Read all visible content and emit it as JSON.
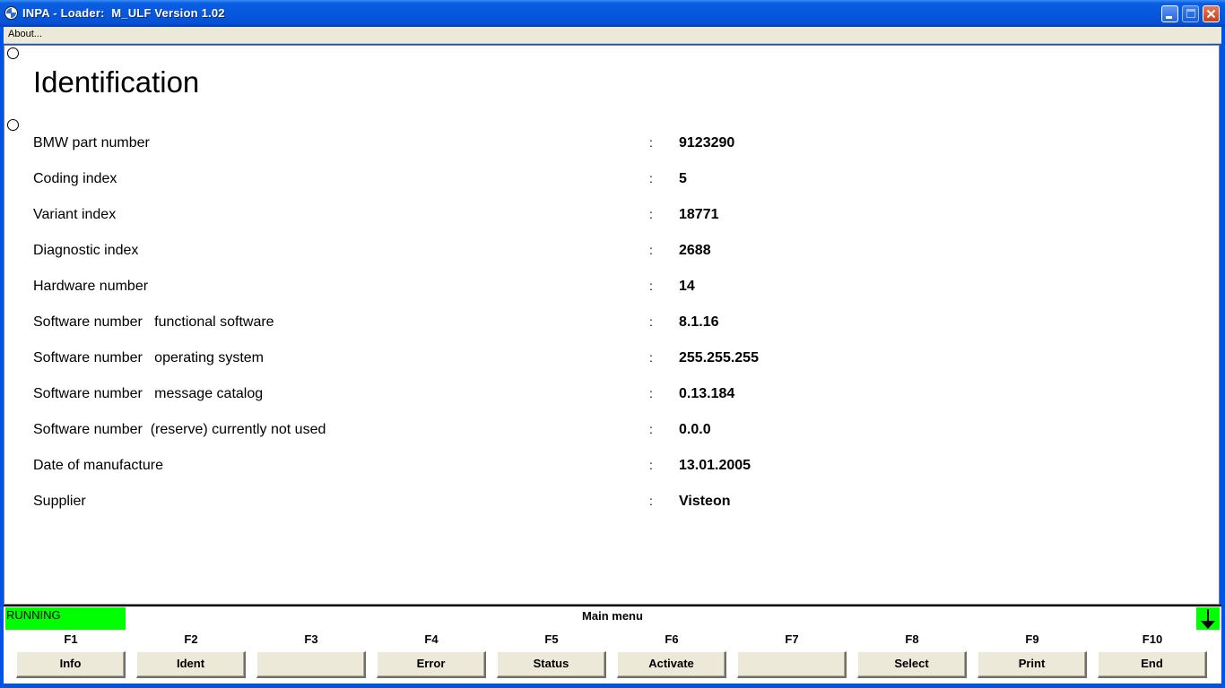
{
  "window": {
    "title": "INPA - Loader:  M_ULF Version 1.02"
  },
  "menu": {
    "about": "About..."
  },
  "page": {
    "title": "Identification"
  },
  "identification": [
    {
      "label": "BMW part number",
      "sep": ":",
      "value": "9123290"
    },
    {
      "label": "Coding index",
      "sep": ":",
      "value": "5"
    },
    {
      "label": "Variant index",
      "sep": ":",
      "value": "18771"
    },
    {
      "label": "Diagnostic index",
      "sep": ":",
      "value": "2688"
    },
    {
      "label": "Hardware number",
      "sep": ":",
      "value": "14"
    },
    {
      "label": "Software number   functional software",
      "sep": ":",
      "value": "8.1.16"
    },
    {
      "label": "Software number   operating system",
      "sep": ":",
      "value": "255.255.255"
    },
    {
      "label": "Software number   message catalog",
      "sep": ":",
      "value": "0.13.184"
    },
    {
      "label": "Software number  (reserve) currently not used",
      "sep": ":",
      "value": "0.0.0"
    },
    {
      "label": "Date of manufacture",
      "sep": ":",
      "value": "13.01.2005"
    },
    {
      "label": "Supplier",
      "sep": ":",
      "value": "Visteon"
    }
  ],
  "status": {
    "state": "RUNNING",
    "menu_caption": "Main menu",
    "indicator_color": "#00ff00"
  },
  "function_keys": [
    {
      "key": "F1",
      "label": "Info"
    },
    {
      "key": "F2",
      "label": "Ident"
    },
    {
      "key": "F3",
      "label": ""
    },
    {
      "key": "F4",
      "label": "Error"
    },
    {
      "key": "F5",
      "label": "Status"
    },
    {
      "key": "F6",
      "label": "Activate"
    },
    {
      "key": "F7",
      "label": ""
    },
    {
      "key": "F8",
      "label": "Select"
    },
    {
      "key": "F9",
      "label": "Print"
    },
    {
      "key": "F10",
      "label": "End"
    }
  ]
}
